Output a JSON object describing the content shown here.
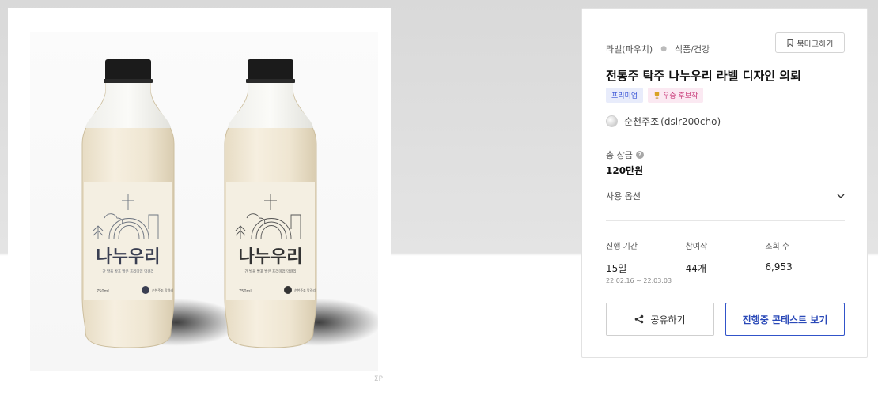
{
  "product_image": {
    "alt": "",
    "bottles": [
      {
        "brand": "나누우리",
        "tagline": "간 발을 발포 발은 프리미엄 막걸리",
        "volume": "750ml",
        "maker": "순천주조 막걸리"
      },
      {
        "brand": "나누우리",
        "tagline": "간 발을 발포 발은 프리미엄 막걸리",
        "volume": "750ml",
        "maker": "순천주조 막걸리"
      }
    ],
    "watermark": "ΣΡ"
  },
  "info": {
    "breadcrumb": [
      "라벨(파우치)",
      "식품/건강"
    ],
    "bookmark_label": "북마크하기",
    "title": "전통주 탁주 나누우리 라벨 디자인 의뢰",
    "badges": {
      "premium": "프리미엄",
      "award": "우승 후보작"
    },
    "author": {
      "name": "순천주조",
      "handle": "(dslr200cho)"
    },
    "prize": {
      "label": "총 상금",
      "value": "120만원"
    },
    "options_label": "사용 옵션",
    "stats": [
      {
        "label": "진행 기간",
        "value": "15일",
        "sub": "22.02.16 ~ 22.03.03"
      },
      {
        "label": "참여작",
        "value": "44개"
      },
      {
        "label": "조회 수",
        "value": "6,953"
      }
    ],
    "share_label": "공유하기",
    "contest_label": "진행중 콘테스트 보기"
  },
  "colors": {
    "accent": "#3153c9",
    "premium_bg": "#e8ecfb",
    "award_bg": "#fbe9f2"
  },
  "icons": [
    "bookmark-icon",
    "trophy-icon",
    "help-icon",
    "chevron-down-icon",
    "share-icon"
  ]
}
